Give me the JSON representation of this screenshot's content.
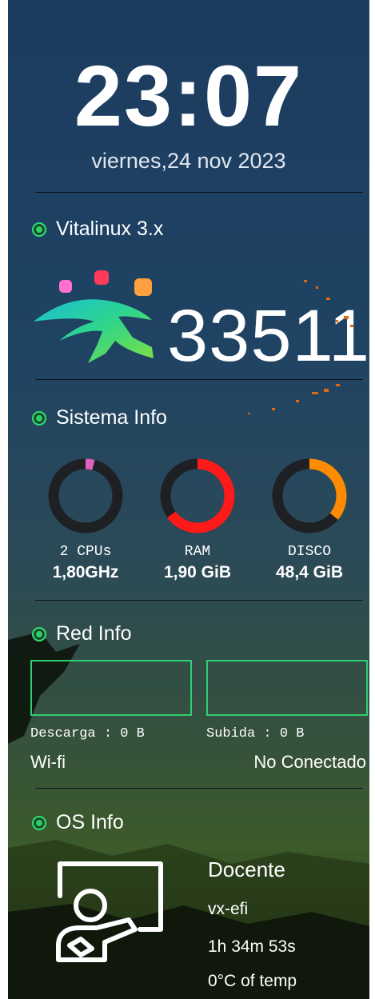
{
  "clock": {
    "time": "23:07",
    "date": "viernes,24 nov 2023"
  },
  "sections": {
    "distro": {
      "title": "Vitalinux 3.x",
      "number": "33511"
    },
    "sistema": {
      "title": "Sistema Info",
      "gauges": [
        {
          "label": "2 CPUs",
          "value": "1,80GHz",
          "fraction": 0.04,
          "color": "#e060c0"
        },
        {
          "label": "RAM",
          "value": "1,90 GiB",
          "fraction": 0.65,
          "color": "#ff1a1a"
        },
        {
          "label": "DISCO",
          "value": "48,4 GiB",
          "fraction": 0.36,
          "color": "#ff8c00"
        }
      ]
    },
    "red": {
      "title": "Red Info",
      "download": "Descarga : 0 B",
      "upload": "Subida : 0 B",
      "interface": "Wi-fi",
      "status": "No Conectado"
    },
    "os": {
      "title": "OS Info",
      "user": "Docente",
      "host": "vx-efi",
      "uptime": "1h 34m 53s",
      "temp": "0°C of temp"
    }
  },
  "colors": {
    "accent": "#2ecf72",
    "gauge_track": "#1e2024"
  }
}
